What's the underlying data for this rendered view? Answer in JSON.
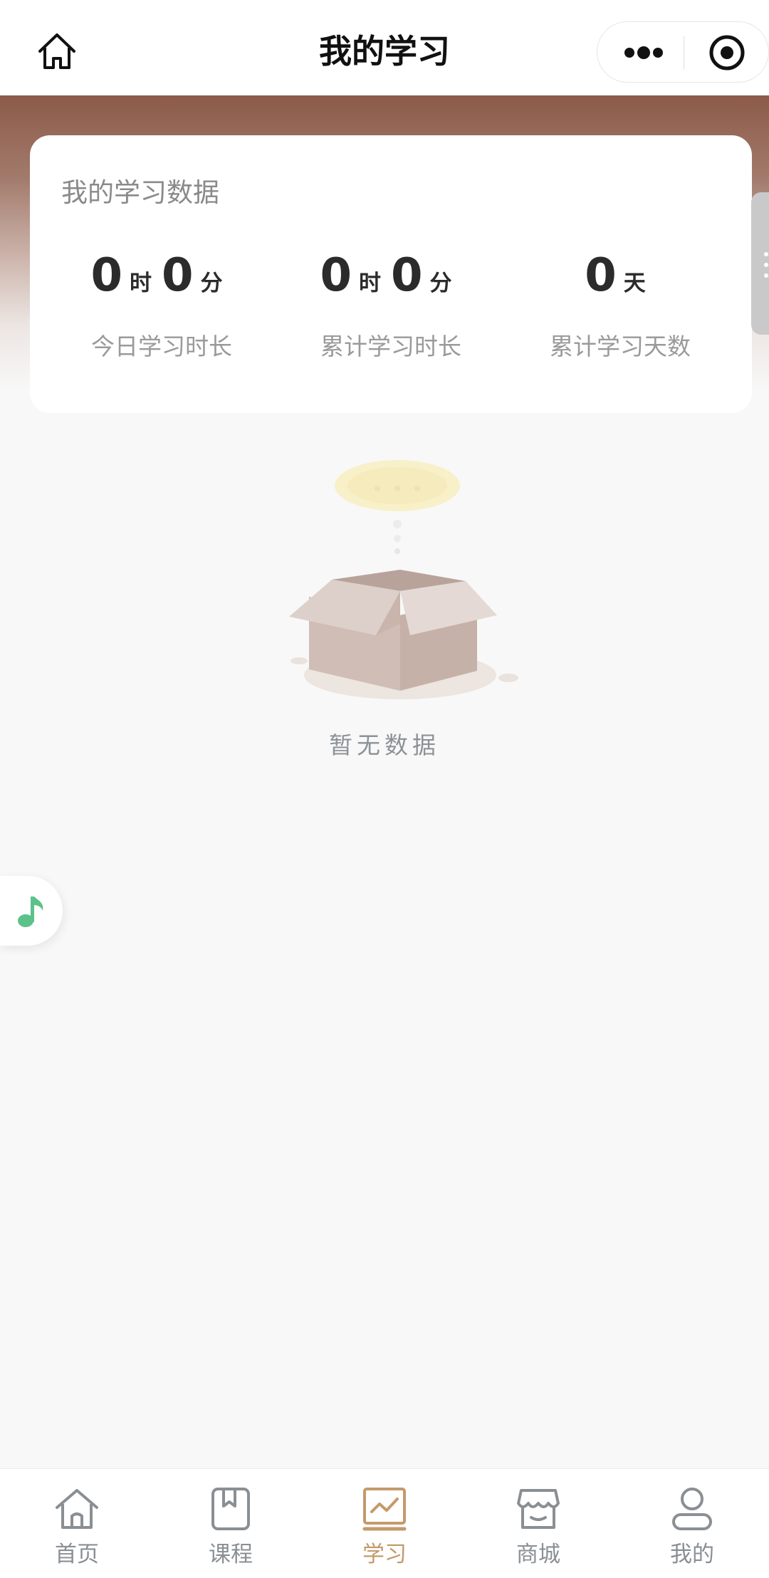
{
  "header": {
    "title": "我的学习",
    "home_icon": "home-icon",
    "more_icon": "more-dots-icon",
    "close_icon": "target-close-icon"
  },
  "stats_card": {
    "title": "我的学习数据",
    "stats": [
      {
        "hours": "0",
        "hour_unit": "时",
        "minutes": "0",
        "minute_unit": "分",
        "label": "今日学习时长"
      },
      {
        "hours": "0",
        "hour_unit": "时",
        "minutes": "0",
        "minute_unit": "分",
        "label": "累计学习时长"
      },
      {
        "days": "0",
        "day_unit": "天",
        "label": "累计学习天数"
      }
    ]
  },
  "empty_state": {
    "text": "暂无数据",
    "icon": "empty-box-icon"
  },
  "music_button": {
    "icon": "music-note-icon"
  },
  "tabbar": {
    "items": [
      {
        "label": "首页",
        "icon": "home-icon",
        "active": false
      },
      {
        "label": "课程",
        "icon": "book-icon",
        "active": false
      },
      {
        "label": "学习",
        "icon": "chart-icon",
        "active": true
      },
      {
        "label": "商城",
        "icon": "store-icon",
        "active": false
      },
      {
        "label": "我的",
        "icon": "user-icon",
        "active": false
      }
    ]
  },
  "colors": {
    "accent": "#c49a6b",
    "banner_top": "#8c5a48",
    "inactive_tab": "#8a8f94",
    "music_note": "#5cc28a"
  }
}
